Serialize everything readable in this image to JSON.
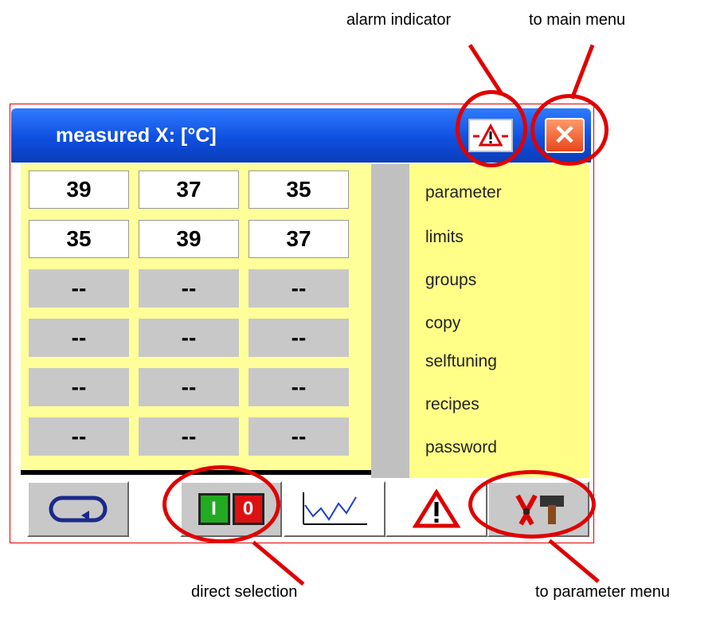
{
  "annotations": {
    "alarm_indicator": "alarm indicator",
    "to_main_menu": "to main menu",
    "direct_selection": "direct selection",
    "to_parameter_menu": "to  parameter  menu"
  },
  "window": {
    "title": "measured X: [°C]",
    "alarm_button": "alarm-triangle-icon",
    "close_label": "✕"
  },
  "grid": {
    "rows": [
      [
        "39",
        "37",
        "35"
      ],
      [
        "35",
        "39",
        "37"
      ],
      [
        "--",
        "--",
        "--"
      ],
      [
        "--",
        "--",
        "--"
      ],
      [
        "--",
        "--",
        "--"
      ],
      [
        "--",
        "--",
        "--"
      ]
    ]
  },
  "menu": {
    "items": [
      "parameter",
      "limits",
      "groups",
      "copy",
      "selftuning",
      "recipes",
      "password"
    ]
  },
  "toolbar": {
    "io_on": "I",
    "io_off": "0"
  },
  "colors": {
    "title_bar": "#1450e0",
    "menu": "#ffff88",
    "annotation": "#e00000"
  }
}
